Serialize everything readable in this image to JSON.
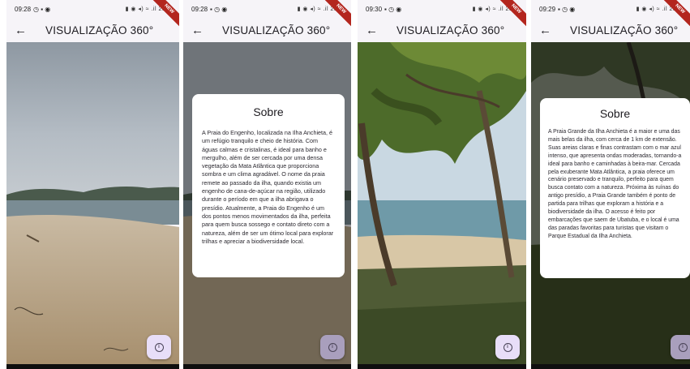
{
  "screens": [
    {
      "status_time": "09:28",
      "status_right": "▮ ◉ ◂) ≈ .il 28%",
      "ribbon": "NEW",
      "app_title": "VISUALIZAÇÃO 360°",
      "back_icon": "arrow-back-icon",
      "dialog": null,
      "fab_icon": "info-icon"
    },
    {
      "status_time": "09:28",
      "status_right": "▮ ◉ ◂) ≈ .il 28%",
      "ribbon": "NEW",
      "app_title": "VISUALIZAÇÃO 360°",
      "back_icon": "arrow-back-icon",
      "dialog": {
        "title": "Sobre",
        "text": "A Praia do Engenho, localizada na Ilha Anchieta, é um refúgio tranquilo e cheio de história. Com águas calmas e cristalinas, é ideal para banho e mergulho, além de ser cercada por uma densa vegetação da Mata Atlântica que proporciona sombra e um clima agradável. O nome da praia remete ao passado da ilha, quando existia um engenho de cana-de-açúcar na região, utilizado durante o período em que a ilha abrigava o presídio. Atualmente, a Praia do Engenho é um dos pontos menos movimentados da ilha, perfeita para quem busca sossego e contato direto com a natureza, além de ser um ótimo local para explorar trilhas e apreciar a biodiversidade local."
      },
      "fab_icon": "info-icon"
    },
    {
      "status_time": "09:30",
      "status_right": "▮ ◉ ◂) ≈ .il 28%",
      "ribbon": "NEW",
      "app_title": "VISUALIZAÇÃO 360°",
      "back_icon": "arrow-back-icon",
      "dialog": null,
      "fab_icon": "info-icon"
    },
    {
      "status_time": "09:29",
      "status_right": "▮ ◉ ◂) ≈ .il 28%",
      "ribbon": "NEW",
      "app_title": "VISUALIZAÇÃO 360°",
      "back_icon": "arrow-back-icon",
      "dialog": {
        "title": "Sobre",
        "text": "A Praia Grande da Ilha Anchieta é a maior e uma das mais belas da ilha, com cerca de 1 km de extensão. Suas areias claras e finas contrastam com o mar azul intenso, que apresenta ondas moderadas, tornando-a ideal para banho e caminhadas à beira-mar. Cercada pela exuberante Mata Atlântica, a praia oferece um cenário preservado e tranquilo, perfeito para quem busca contato com a natureza. Próxima às ruínas do antigo presídio, a Praia Grande também é ponto de partida para trilhas que exploram a história e a biodiversidade da ilha. O acesso é feito por embarcações que saem de Ubatuba, e o local é uma das paradas favoritas para turistas que visitam o Parque Estadual da Ilha Anchieta."
      },
      "fab_icon": "info-icon"
    }
  ]
}
